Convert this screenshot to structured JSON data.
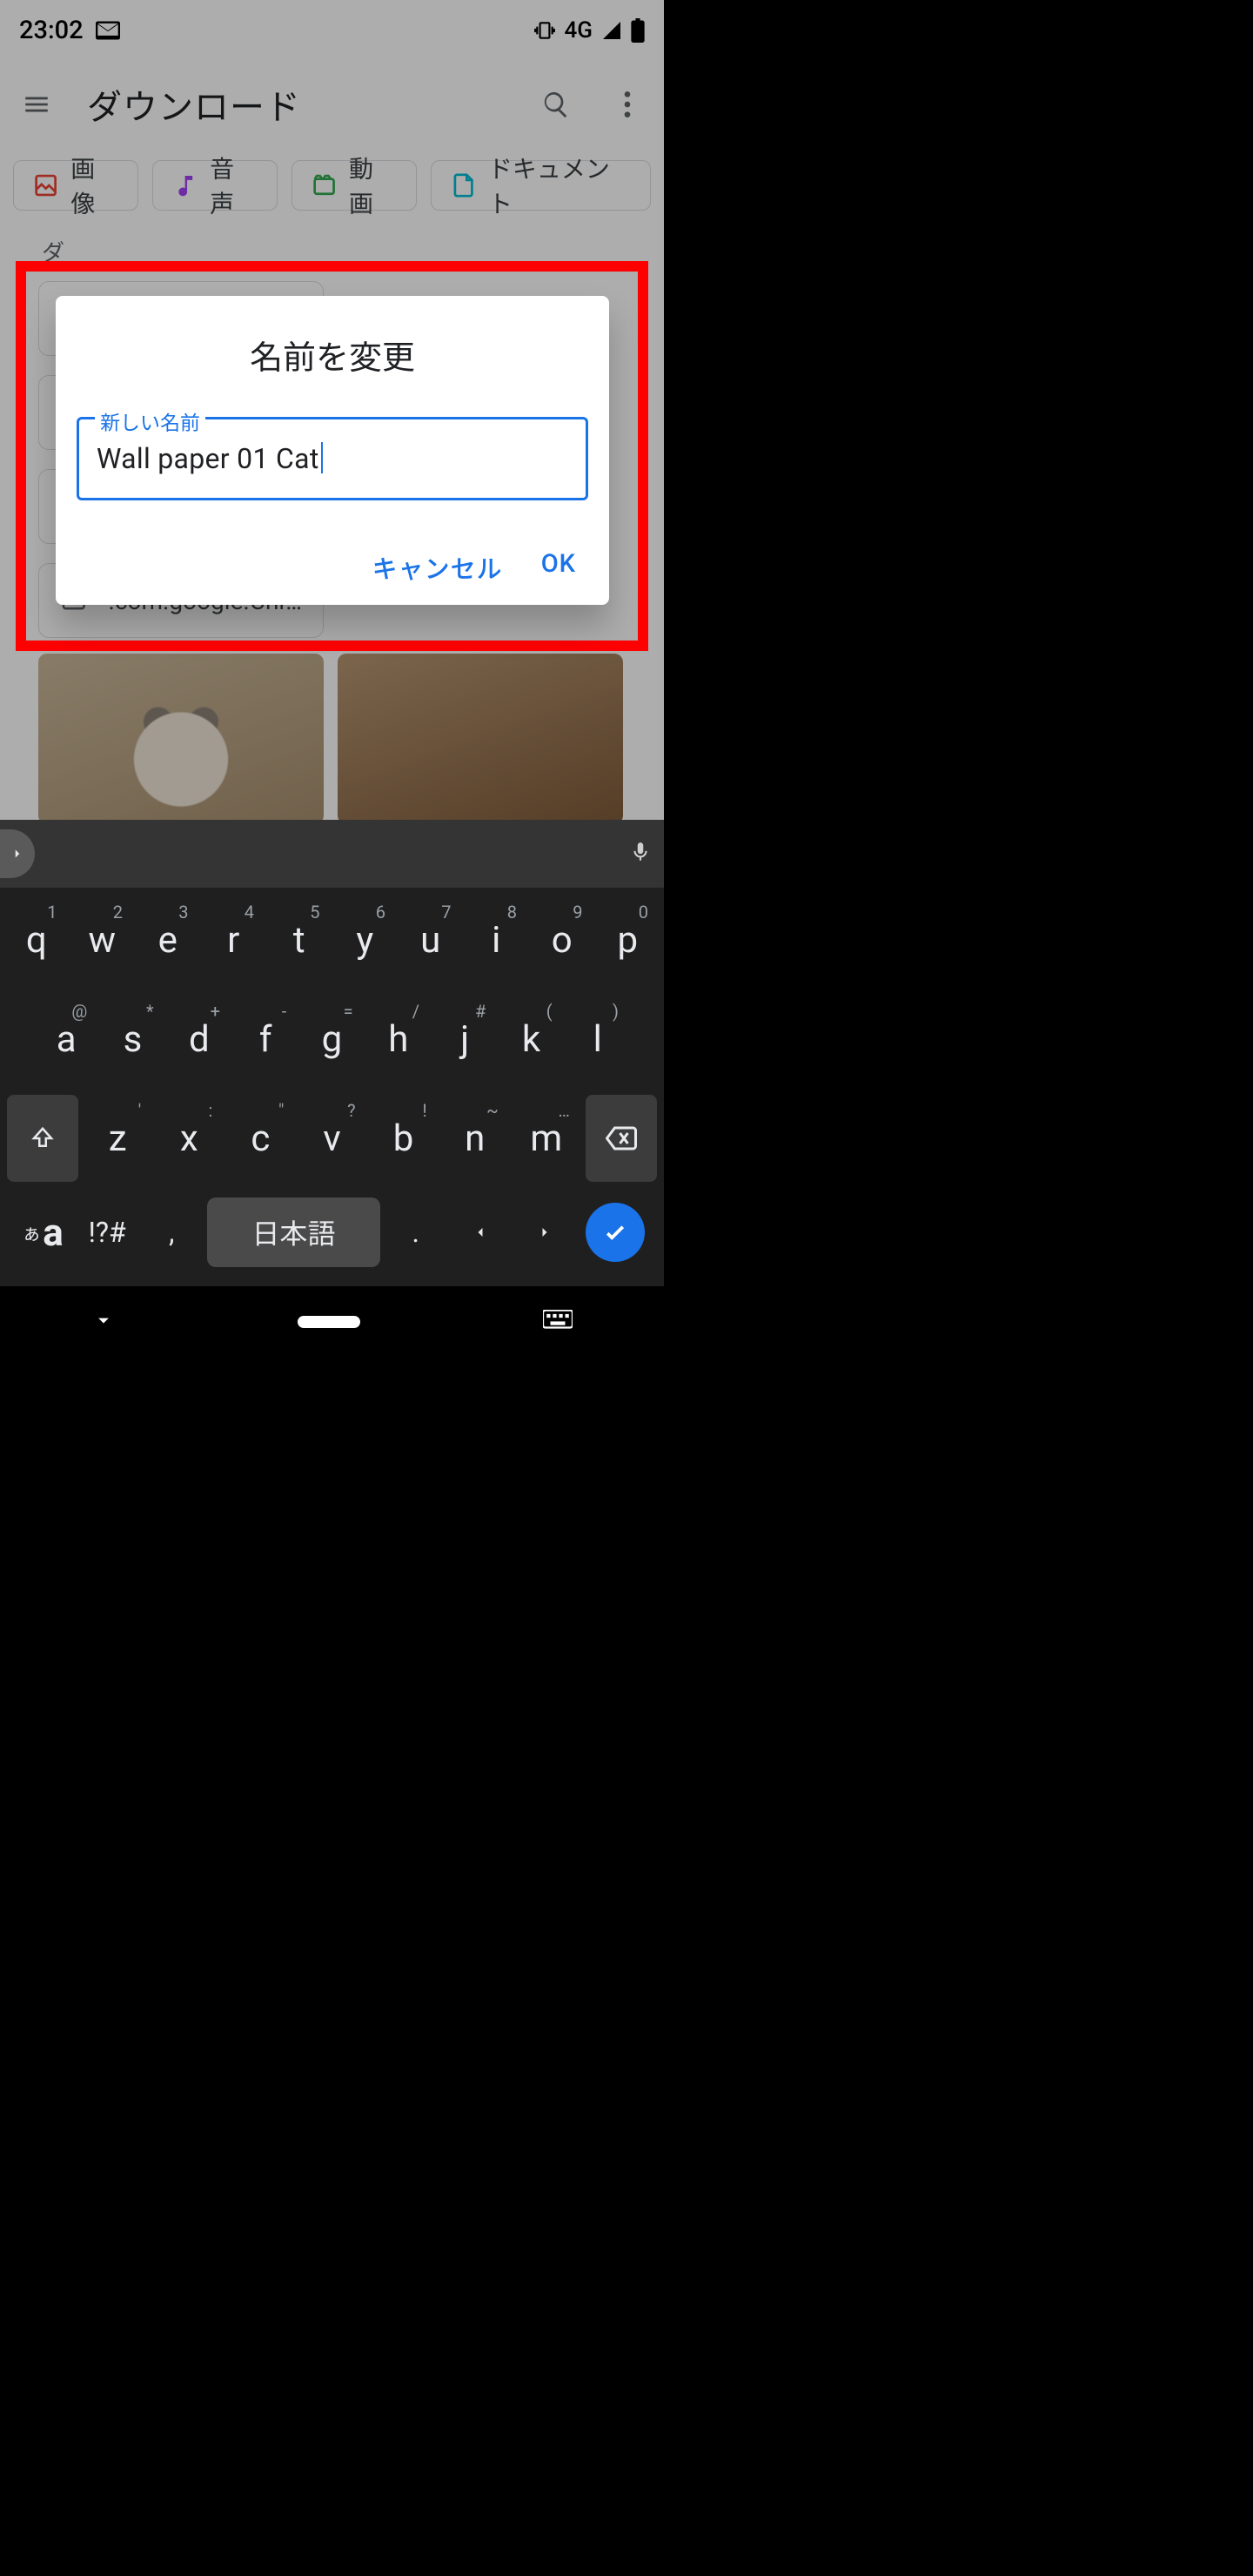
{
  "status": {
    "time": "23:02",
    "network": "4G"
  },
  "appbar": {
    "title": "ダウンロード"
  },
  "chips": {
    "image": "画像",
    "audio": "音声",
    "video": "動画",
    "document": "ドキュメント"
  },
  "section_label": "ダ",
  "folders": {
    "chrome": ".com.google.Chr…"
  },
  "dialog": {
    "title": "名前を変更",
    "field_label": "新しい名前",
    "value": "Wall paper 01 Cat",
    "cancel": "キャンセル",
    "ok": "OK"
  },
  "keyboard": {
    "row1": [
      {
        "k": "q",
        "s": "1"
      },
      {
        "k": "w",
        "s": "2"
      },
      {
        "k": "e",
        "s": "3"
      },
      {
        "k": "r",
        "s": "4"
      },
      {
        "k": "t",
        "s": "5"
      },
      {
        "k": "y",
        "s": "6"
      },
      {
        "k": "u",
        "s": "7"
      },
      {
        "k": "i",
        "s": "8"
      },
      {
        "k": "o",
        "s": "9"
      },
      {
        "k": "p",
        "s": "0"
      }
    ],
    "row2": [
      {
        "k": "a",
        "s": "@"
      },
      {
        "k": "s",
        "s": "*"
      },
      {
        "k": "d",
        "s": "+"
      },
      {
        "k": "f",
        "s": "-"
      },
      {
        "k": "g",
        "s": "="
      },
      {
        "k": "h",
        "s": "/"
      },
      {
        "k": "j",
        "s": "#"
      },
      {
        "k": "k",
        "s": "("
      },
      {
        "k": "l",
        "s": ")"
      }
    ],
    "row3": [
      {
        "k": "z",
        "s": "'"
      },
      {
        "k": "x",
        "s": ":"
      },
      {
        "k": "c",
        "s": "\""
      },
      {
        "k": "v",
        "s": "?"
      },
      {
        "k": "b",
        "s": "!"
      },
      {
        "k": "n",
        "s": "~"
      },
      {
        "k": "m",
        "s": "…"
      }
    ],
    "lang_toggle": "ぁa",
    "sym": "!?#",
    "comma": ",",
    "space": "日本語",
    "period": "."
  }
}
